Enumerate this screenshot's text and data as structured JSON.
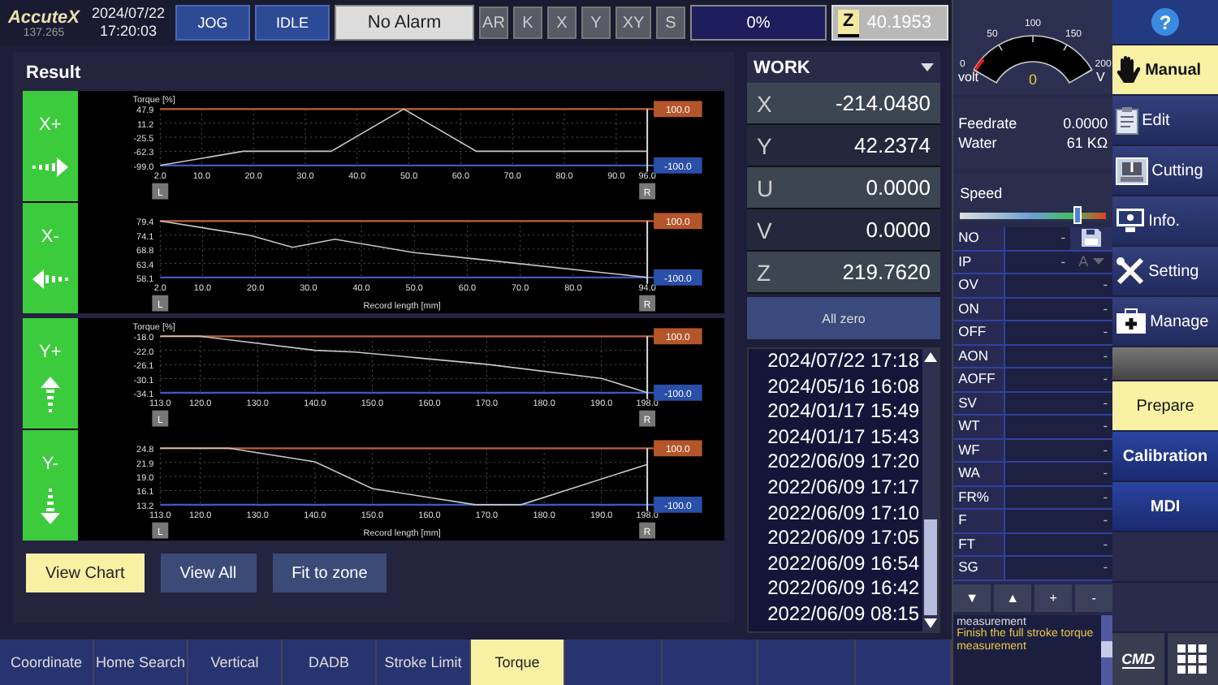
{
  "top_bar": {
    "logo": "AccuteX",
    "version": "137.265",
    "date": "2024/07/22",
    "time": "17:20:03",
    "mode_buttons": [
      "JOG",
      "IDLE"
    ],
    "alarm": "No Alarm",
    "axis_buttons": [
      "AR",
      "K",
      "X",
      "Y",
      "XY",
      "S"
    ],
    "progress": {
      "reading": "0%",
      "level": 0
    },
    "z_axis": {
      "label": "Z",
      "value": "40.1953"
    }
  },
  "result_panel": {
    "title": "Result",
    "groups": [
      {
        "charts": [
          {
            "button": "X+",
            "kind": "right",
            "upper_limit": "100.0",
            "lower_limit": "-100.0",
            "left_marker": "L",
            "right_marker": "R",
            "chart_data": {
              "type": "line",
              "grid": true,
              "ylabel": "Torque [%]",
              "x": [
                2,
                18,
                35,
                49,
                63,
                96
              ],
              "series": [
                {
                  "color": "#c8c8c8",
                  "values": [
                    -99,
                    -62,
                    -62,
                    47.9,
                    -62,
                    -62
                  ]
                }
              ],
              "xlim": [
                2,
                96
              ],
              "ylim": [
                -99,
                47.9
              ],
              "xticks": [
                {
                  "value": 2,
                  "label": "2.0"
                },
                {
                  "value": 10,
                  "label": "10.0"
                },
                {
                  "value": 20,
                  "label": "20.0"
                },
                {
                  "value": 30,
                  "label": "30.0"
                },
                {
                  "value": 40,
                  "label": "40.0"
                },
                {
                  "value": 50,
                  "label": "50.0"
                },
                {
                  "value": 60,
                  "label": "60.0"
                },
                {
                  "value": 70,
                  "label": "70.0"
                },
                {
                  "value": 80,
                  "label": "80.0"
                },
                {
                  "value": 90,
                  "label": "90.0"
                },
                {
                  "value": 96,
                  "label": "96.0"
                }
              ],
              "yticks": [
                {
                  "value": 47.9,
                  "label": "47.9"
                },
                {
                  "value": 11.2,
                  "label": "11.2"
                },
                {
                  "value": -25.5,
                  "label": "-25.5"
                },
                {
                  "value": -62.3,
                  "label": "-62.3"
                },
                {
                  "value": -99,
                  "label": "-99.0"
                }
              ]
            }
          },
          {
            "button": "X-",
            "kind": "left",
            "upper_limit": "100.0",
            "lower_limit": "-100.0",
            "left_marker": "L",
            "right_marker": "R",
            "chart_data": {
              "type": "line",
              "grid": true,
              "xlabel": "Record length [mm]",
              "x": [
                2,
                19,
                27,
                35,
                50,
                62,
                94
              ],
              "series": [
                {
                  "color": "#c8c8c8",
                  "values": [
                    79.4,
                    74,
                    69.5,
                    72.5,
                    67.5,
                    65,
                    58.1
                  ]
                }
              ],
              "xlim": [
                2,
                94
              ],
              "ylim": [
                58.1,
                79.4
              ],
              "xticks": [
                {
                  "value": 2,
                  "label": "2.0"
                },
                {
                  "value": 10,
                  "label": "10.0"
                },
                {
                  "value": 20,
                  "label": "20.0"
                },
                {
                  "value": 30,
                  "label": "30.0"
                },
                {
                  "value": 40,
                  "label": "40.0"
                },
                {
                  "value": 50,
                  "label": "50.0"
                },
                {
                  "value": 60,
                  "label": "60.0"
                },
                {
                  "value": 70,
                  "label": "70.0"
                },
                {
                  "value": 80,
                  "label": "80.0"
                },
                {
                  "value": 94,
                  "label": "94.0"
                }
              ],
              "yticks": [
                {
                  "value": 79.4,
                  "label": "79.4"
                },
                {
                  "value": 74.1,
                  "label": "74.1"
                },
                {
                  "value": 68.8,
                  "label": "68.8"
                },
                {
                  "value": 63.4,
                  "label": "63.4"
                },
                {
                  "value": 58.1,
                  "label": "58.1"
                }
              ]
            }
          }
        ]
      },
      {
        "charts": [
          {
            "button": "Y+",
            "kind": "up",
            "upper_limit": "100.0",
            "lower_limit": "-100.0",
            "left_marker": "L",
            "right_marker": "R",
            "chart_data": {
              "type": "line",
              "grid": true,
              "ylabel": "Torque [%]",
              "x": [
                113,
                120,
                140,
                147,
                170,
                190,
                198
              ],
              "series": [
                {
                  "color": "#c8c8c8",
                  "values": [
                    -18,
                    -18,
                    -22,
                    -22.5,
                    -26,
                    -30,
                    -34.1
                  ]
                }
              ],
              "xlim": [
                113,
                198
              ],
              "ylim": [
                -34.1,
                -18
              ],
              "xticks": [
                {
                  "value": 113,
                  "label": "113.0"
                },
                {
                  "value": 120,
                  "label": "120.0"
                },
                {
                  "value": 130,
                  "label": "130.0"
                },
                {
                  "value": 140,
                  "label": "140.0"
                },
                {
                  "value": 150,
                  "label": "150.0"
                },
                {
                  "value": 160,
                  "label": "160.0"
                },
                {
                  "value": 170,
                  "label": "170.0"
                },
                {
                  "value": 180,
                  "label": "180.0"
                },
                {
                  "value": 190,
                  "label": "190.0"
                },
                {
                  "value": 198,
                  "label": "198.0"
                }
              ],
              "yticks": [
                {
                  "value": -18,
                  "label": "-18.0"
                },
                {
                  "value": -22,
                  "label": "-22.0"
                },
                {
                  "value": -26.1,
                  "label": "-26.1"
                },
                {
                  "value": -30.1,
                  "label": "-30.1"
                },
                {
                  "value": -34.1,
                  "label": "-34.1"
                }
              ]
            }
          },
          {
            "button": "Y-",
            "kind": "down",
            "upper_limit": "100.0",
            "lower_limit": "-100.0",
            "left_marker": "L",
            "right_marker": "R",
            "chart_data": {
              "type": "line",
              "grid": true,
              "xlabel": "Record length [mm]",
              "x": [
                113,
                125,
                140,
                150,
                168,
                176,
                198
              ],
              "series": [
                {
                  "color": "#c8c8c8",
                  "values": [
                    24.8,
                    24.8,
                    22,
                    16.5,
                    13.2,
                    13.2,
                    21.5
                  ]
                }
              ],
              "xlim": [
                113,
                198
              ],
              "ylim": [
                13.2,
                24.8
              ],
              "xticks": [
                {
                  "value": 113,
                  "label": "113.0"
                },
                {
                  "value": 120,
                  "label": "120.0"
                },
                {
                  "value": 130,
                  "label": "130.0"
                },
                {
                  "value": 140,
                  "label": "140.0"
                },
                {
                  "value": 150,
                  "label": "150.0"
                },
                {
                  "value": 160,
                  "label": "160.0"
                },
                {
                  "value": 170,
                  "label": "170.0"
                },
                {
                  "value": 180,
                  "label": "180.0"
                },
                {
                  "value": 190,
                  "label": "190.0"
                },
                {
                  "value": 198,
                  "label": "198.0"
                }
              ],
              "yticks": [
                {
                  "value": 24.8,
                  "label": "24.8"
                },
                {
                  "value": 21.9,
                  "label": "21.9"
                },
                {
                  "value": 19,
                  "label": "19.0"
                },
                {
                  "value": 16.1,
                  "label": "16.1"
                },
                {
                  "value": 13.2,
                  "label": "13.2"
                }
              ]
            }
          }
        ]
      }
    ],
    "actions": [
      {
        "label": "View Chart",
        "selected": true
      },
      {
        "label": "View All",
        "selected": false
      },
      {
        "label": "Fit to zone",
        "selected": false
      }
    ]
  },
  "coordinates": {
    "frame": "WORK",
    "axes": [
      {
        "name": "X",
        "value": "-214.0480"
      },
      {
        "name": "Y",
        "value": "42.2374"
      },
      {
        "name": "U",
        "value": "0.0000"
      },
      {
        "name": "V",
        "value": "0.0000"
      },
      {
        "name": "Z",
        "value": "219.7620"
      }
    ],
    "zero_button": "All zero",
    "history": [
      "2024/07/22 17:18",
      "2024/05/16 16:08",
      "2024/01/17 15:49",
      "2024/01/17 15:43",
      "2022/06/09 17:20",
      "2022/06/09 17:17",
      "2022/06/09 17:10",
      "2022/06/09 17:05",
      "2022/06/09 16:54",
      "2022/06/09 16:42",
      "2022/06/09 08:15"
    ]
  },
  "status": {
    "gauge": {
      "scale": [
        "0",
        "50",
        "100",
        "150",
        "200"
      ],
      "quantity": "volt",
      "reading": "0",
      "unit": "V"
    },
    "readouts": [
      {
        "label": "Feedrate",
        "value": "0.0000"
      },
      {
        "label": "Water",
        "value": "61 KΩ"
      }
    ],
    "speed": {
      "label": "Speed",
      "level": 0.81
    },
    "params": [
      {
        "name": "NO",
        "value": "-",
        "kind": "save"
      },
      {
        "name": "IP",
        "value": "-",
        "kind": "unit",
        "unit": "A"
      },
      {
        "name": "OV",
        "value": "-",
        "kind": "plain"
      },
      {
        "name": "ON",
        "value": "-",
        "kind": "plain"
      },
      {
        "name": "OFF",
        "value": "-",
        "kind": "plain"
      },
      {
        "name": "AON",
        "value": "-",
        "kind": "plain"
      },
      {
        "name": "AOFF",
        "value": "-",
        "kind": "plain"
      },
      {
        "name": "SV",
        "value": "-",
        "kind": "plain"
      },
      {
        "name": "WT",
        "value": "-",
        "kind": "plain"
      },
      {
        "name": "WF",
        "value": "-",
        "kind": "plain"
      },
      {
        "name": "WA",
        "value": "-",
        "kind": "plain"
      },
      {
        "name": "FR%",
        "value": "-",
        "kind": "plain"
      },
      {
        "name": "F",
        "value": "-",
        "kind": "plain"
      },
      {
        "name": "FT",
        "value": "-",
        "kind": "plain"
      },
      {
        "name": "SG",
        "value": "-",
        "kind": "plain"
      }
    ],
    "param_buttons": [
      "▼",
      "▲",
      "+",
      "-"
    ],
    "message": {
      "title": "measurement",
      "text": "Finish the full stroke torque measurement"
    }
  },
  "nav": {
    "help": "?",
    "menu": [
      {
        "label": "Manual",
        "selected": true
      },
      {
        "label": "Edit",
        "selected": false
      },
      {
        "label": "Cutting",
        "selected": false
      },
      {
        "label": "Info.",
        "selected": false
      },
      {
        "label": "Setting",
        "selected": false
      },
      {
        "label": "Manage",
        "selected": false
      }
    ],
    "submenu": [
      {
        "label": "Prepare",
        "selected": true
      },
      {
        "label": "Calibration",
        "selected": false
      },
      {
        "label": "MDI",
        "selected": false
      }
    ],
    "cmd": "CMD"
  },
  "bottom_tabs": [
    {
      "label": "Coordinate",
      "selected": false
    },
    {
      "label": "Home Search",
      "selected": false
    },
    {
      "label": "Vertical",
      "selected": false
    },
    {
      "label": "DADB",
      "selected": false
    },
    {
      "label": "Stroke Limit",
      "selected": false
    },
    {
      "label": "Torque",
      "selected": true
    }
  ]
}
